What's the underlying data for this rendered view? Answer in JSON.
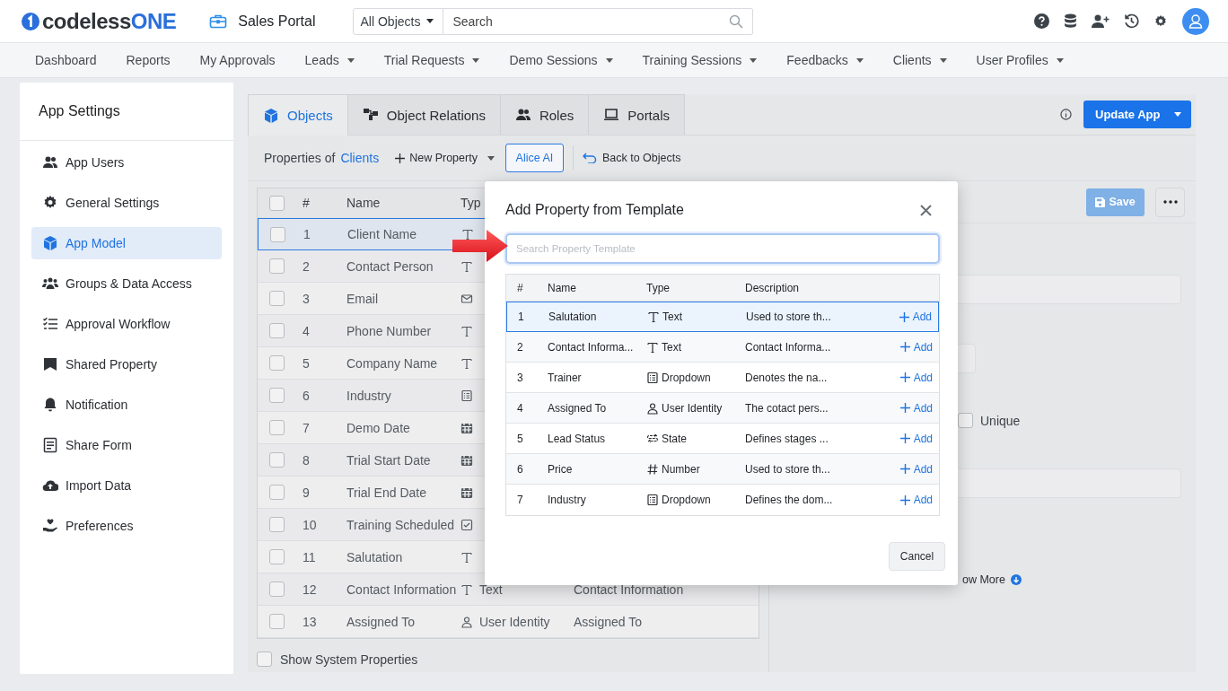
{
  "header": {
    "logo": {
      "name": "codeless",
      "accent": "ONE"
    },
    "app_title": "Sales Portal",
    "search": {
      "scope": "All Objects",
      "placeholder": "Search"
    }
  },
  "nav": [
    {
      "label": "Dashboard",
      "has_menu": false
    },
    {
      "label": "Reports",
      "has_menu": false
    },
    {
      "label": "My Approvals",
      "has_menu": false
    },
    {
      "label": "Leads",
      "has_menu": true
    },
    {
      "label": "Trial Requests",
      "has_menu": true
    },
    {
      "label": "Demo Sessions",
      "has_menu": true
    },
    {
      "label": "Training Sessions",
      "has_menu": true
    },
    {
      "label": "Feedbacks",
      "has_menu": true
    },
    {
      "label": "Clients",
      "has_menu": true
    },
    {
      "label": "User Profiles",
      "has_menu": true
    }
  ],
  "sidebar": {
    "title": "App Settings",
    "items": [
      {
        "label": "App Users",
        "kind": "users",
        "selected": false
      },
      {
        "label": "General Settings",
        "kind": "gear",
        "selected": false
      },
      {
        "label": "App Model",
        "kind": "cube",
        "selected": true
      },
      {
        "label": "Groups & Data Access",
        "kind": "group",
        "selected": false
      },
      {
        "label": "Approval Workflow",
        "kind": "checklist",
        "selected": false
      },
      {
        "label": "Shared Property",
        "kind": "bookmark",
        "selected": false
      },
      {
        "label": "Notification",
        "kind": "bell",
        "selected": false
      },
      {
        "label": "Share Form",
        "kind": "form",
        "selected": false
      },
      {
        "label": "Import Data",
        "kind": "upload",
        "selected": false
      },
      {
        "label": "Preferences",
        "kind": "heart",
        "selected": false
      }
    ]
  },
  "tabs": [
    {
      "label": "Objects",
      "kind": "cube",
      "selected": true
    },
    {
      "label": "Object Relations",
      "kind": "relations",
      "selected": false
    },
    {
      "label": "Roles",
      "kind": "users",
      "selected": false
    },
    {
      "label": "Portals",
      "kind": "laptop",
      "selected": false
    }
  ],
  "update_button": "Update App",
  "toolbar": {
    "prefix": "Properties of",
    "object": "Clients",
    "new_property": "New Property",
    "ai_button": "Alice AI",
    "back": "Back to Objects"
  },
  "properties": {
    "columns": [
      "#",
      "Name",
      "Typ"
    ],
    "all_selected": false,
    "rows": [
      {
        "num": "1",
        "name": "Client Name",
        "kind": "text",
        "selected": true
      },
      {
        "num": "2",
        "name": "Contact Person",
        "kind": "text",
        "selected": false
      },
      {
        "num": "3",
        "name": "Email",
        "kind": "email",
        "selected": false
      },
      {
        "num": "4",
        "name": "Phone Number",
        "kind": "text",
        "selected": false
      },
      {
        "num": "5",
        "name": "Company Name",
        "kind": "text",
        "selected": false
      },
      {
        "num": "6",
        "name": "Industry",
        "kind": "dropdown",
        "selected": false
      },
      {
        "num": "7",
        "name": "Demo Date",
        "kind": "date",
        "selected": false
      },
      {
        "num": "8",
        "name": "Trial Start Date",
        "kind": "date",
        "selected": false
      },
      {
        "num": "9",
        "name": "Trial End Date",
        "kind": "date",
        "selected": false
      },
      {
        "num": "10",
        "name": "Training Scheduled",
        "kind": "checkbox",
        "selected": false
      },
      {
        "num": "11",
        "name": "Salutation",
        "kind": "text",
        "selected": false
      },
      {
        "num": "12",
        "name": "Contact Information",
        "kind": "text",
        "type_label": "Text",
        "description": "Contact Information",
        "selected": false
      },
      {
        "num": "13",
        "name": "Assigned To",
        "kind": "user",
        "type_label": "User Identity",
        "description": "Assigned To",
        "selected": false
      }
    ],
    "show_system": {
      "label": "Show System Properties",
      "checked": false
    }
  },
  "details": {
    "save": "Save",
    "unique": {
      "label": "Unique",
      "checked": false
    },
    "more_link": "ow More"
  },
  "dialog": {
    "title": "Add Property from Template",
    "search_placeholder": "Search Property Template",
    "columns": [
      "#",
      "Name",
      "Type",
      "Description"
    ],
    "rows": [
      {
        "num": "1",
        "name": "Salutation",
        "kind": "text",
        "type_label": "Text",
        "description": "Used to store th...",
        "action": "Add",
        "selected": true
      },
      {
        "num": "2",
        "name": "Contact Informa...",
        "kind": "text",
        "type_label": "Text",
        "description": "Contact Informa...",
        "action": "Add",
        "selected": false
      },
      {
        "num": "3",
        "name": "Trainer",
        "kind": "dropdown",
        "type_label": "Dropdown",
        "description": "Denotes the na...",
        "action": "Add",
        "selected": false
      },
      {
        "num": "4",
        "name": "Assigned To",
        "kind": "user",
        "type_label": "User Identity",
        "description": "The cotact pers...",
        "action": "Add",
        "selected": false
      },
      {
        "num": "5",
        "name": "Lead Status",
        "kind": "state",
        "type_label": "State",
        "description": "Defines stages ...",
        "action": "Add",
        "selected": false
      },
      {
        "num": "6",
        "name": "Price",
        "kind": "number",
        "type_label": "Number",
        "description": "Used to store th...",
        "action": "Add",
        "selected": false
      },
      {
        "num": "7",
        "name": "Industry",
        "kind": "dropdown",
        "type_label": "Dropdown",
        "description": "Defines the dom...",
        "action": "Add",
        "selected": false
      }
    ],
    "cancel": "Cancel"
  }
}
